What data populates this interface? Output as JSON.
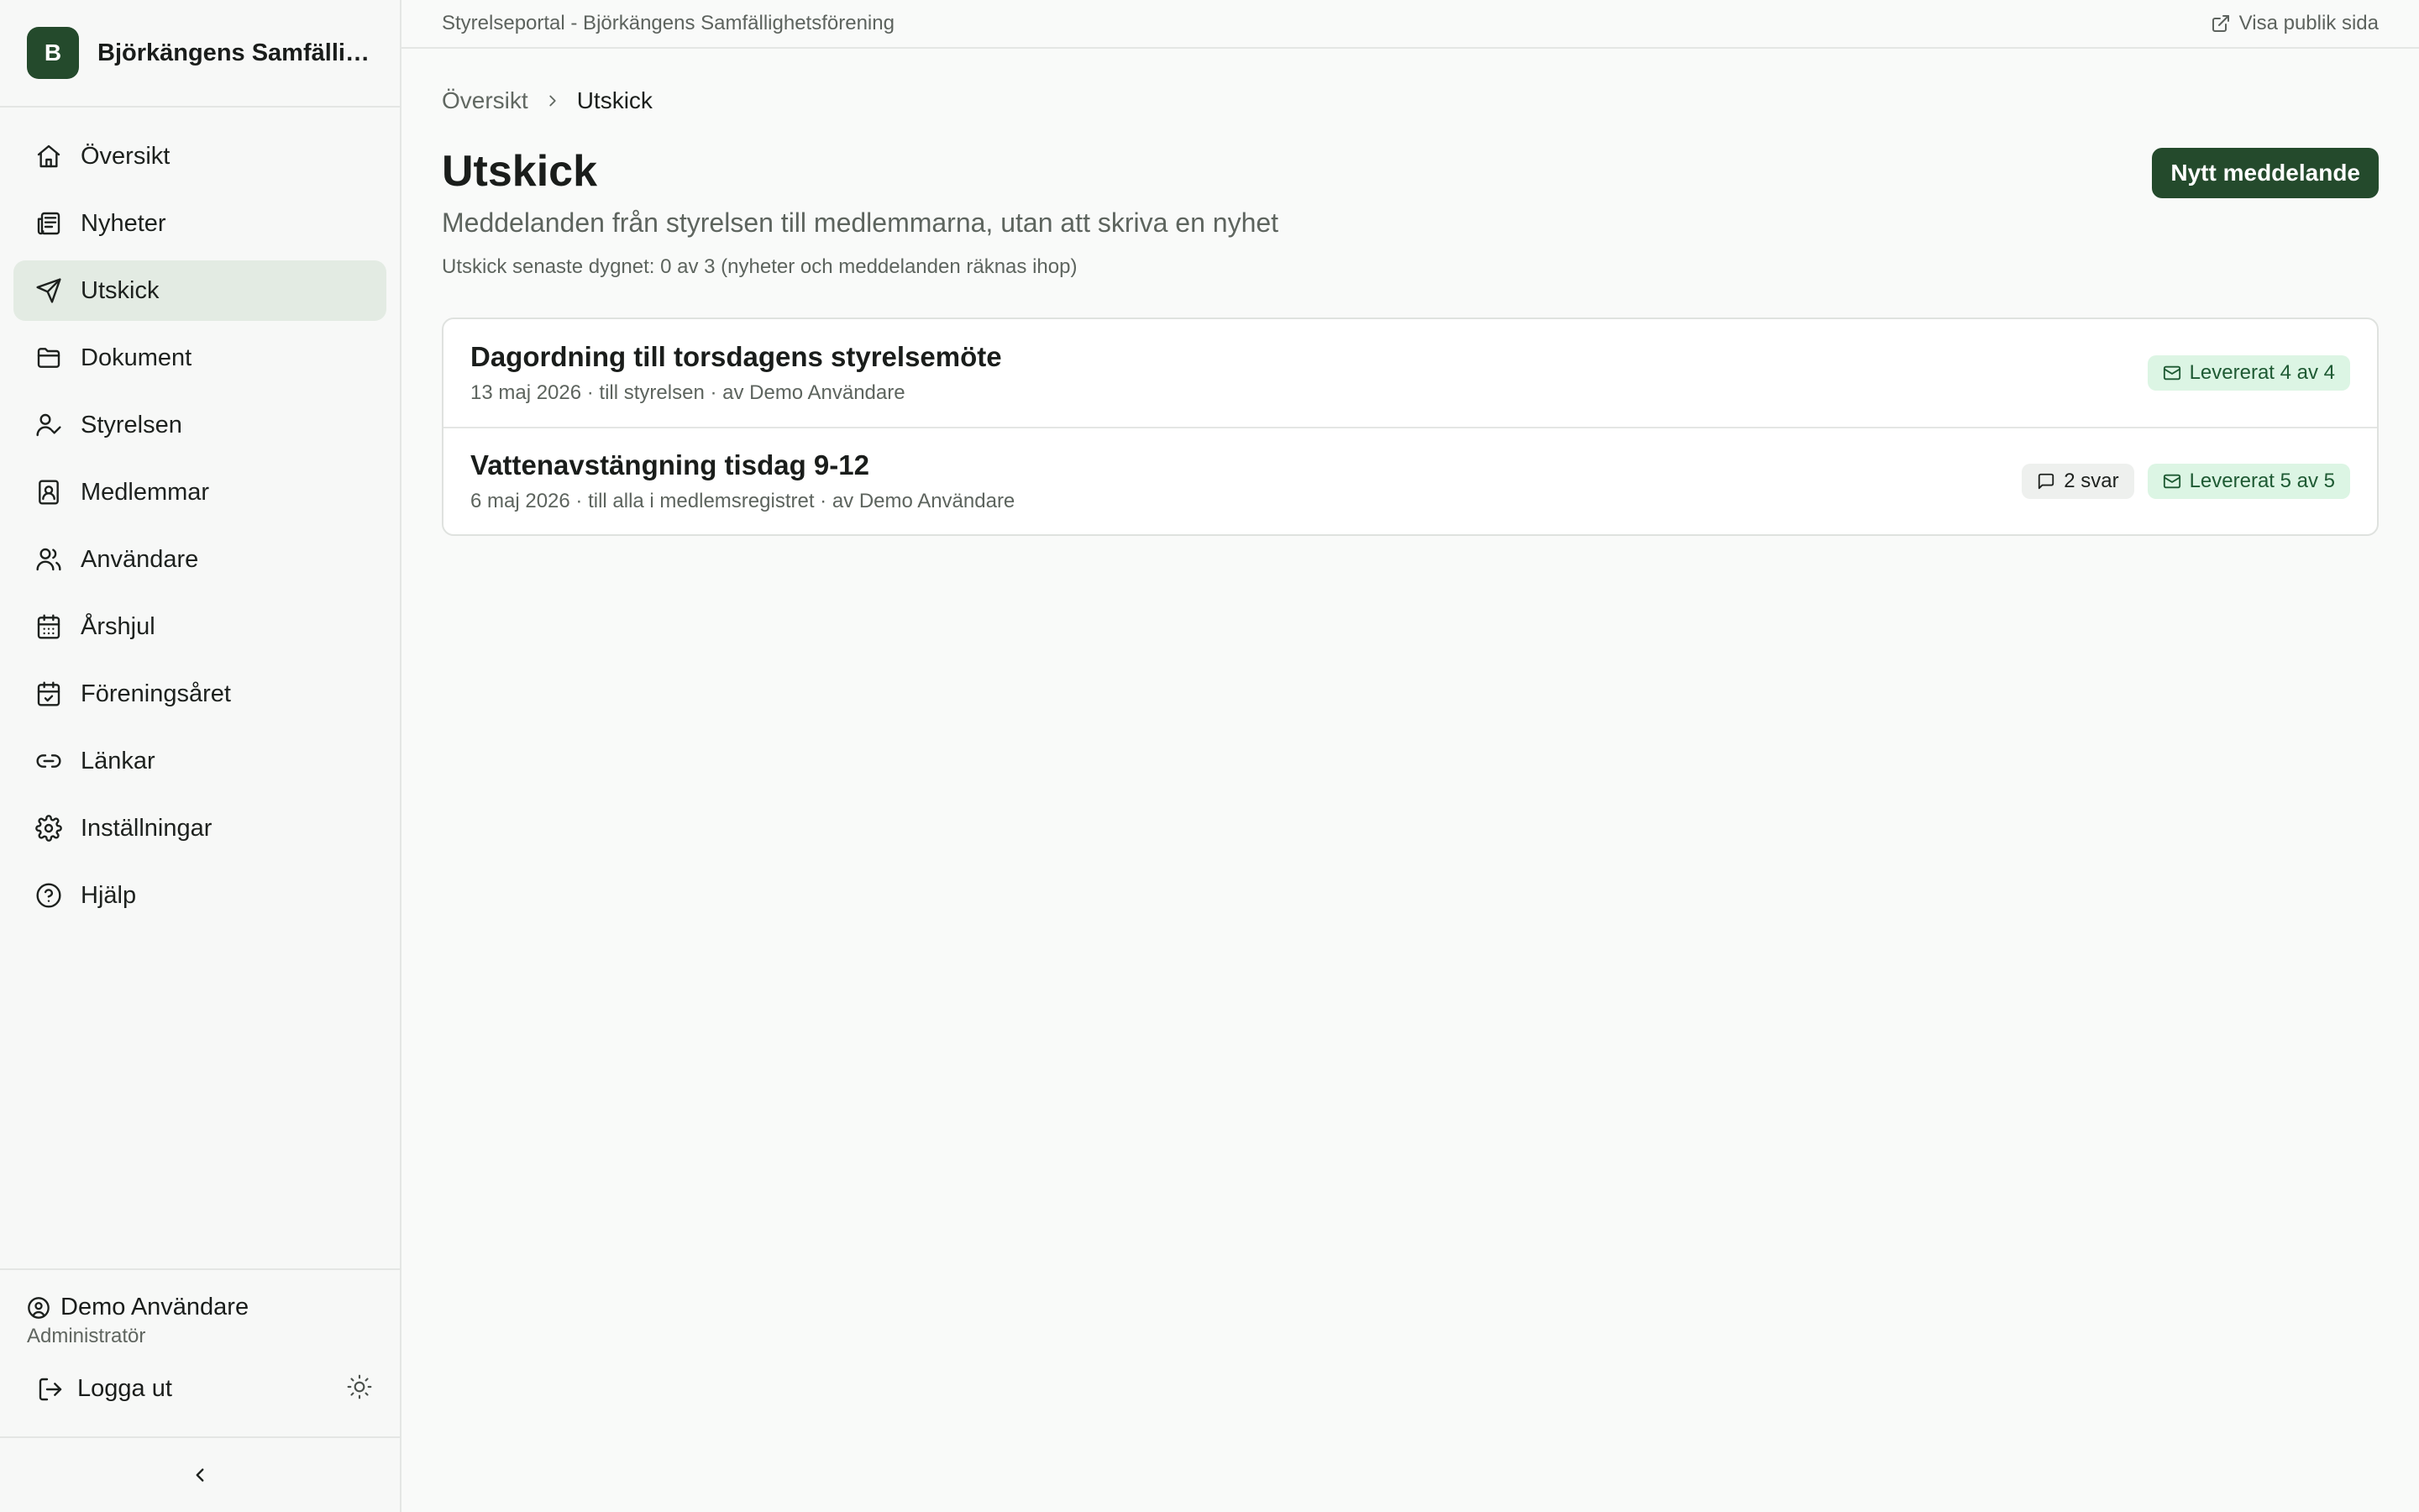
{
  "brand": {
    "initial": "B",
    "name": "Björkängens Samfällig..."
  },
  "nav": [
    {
      "label": "Översikt",
      "icon": "home-icon"
    },
    {
      "label": "Nyheter",
      "icon": "newspaper-icon"
    },
    {
      "label": "Utskick",
      "icon": "send-icon",
      "active": true
    },
    {
      "label": "Dokument",
      "icon": "folder-icon"
    },
    {
      "label": "Styrelsen",
      "icon": "user-check-icon"
    },
    {
      "label": "Medlemmar",
      "icon": "contact-book-icon"
    },
    {
      "label": "Användare",
      "icon": "users-icon"
    },
    {
      "label": "Årshjul",
      "icon": "calendar-icon"
    },
    {
      "label": "Föreningsåret",
      "icon": "calendar-check-icon"
    },
    {
      "label": "Länkar",
      "icon": "link-icon"
    },
    {
      "label": "Inställningar",
      "icon": "gear-icon"
    },
    {
      "label": "Hjälp",
      "icon": "help-icon"
    }
  ],
  "user": {
    "name": "Demo Användare",
    "role": "Administratör",
    "logout": "Logga ut"
  },
  "topbar": {
    "title": "Styrelseportal - Björkängens Samfällighetsförening",
    "public_link": "Visa publik sida"
  },
  "breadcrumb": {
    "root": "Översikt",
    "current": "Utskick"
  },
  "page": {
    "title": "Utskick",
    "subtitle": "Meddelanden från styrelsen till medlemmarna, utan att skriva en nyhet",
    "quota": "Utskick senaste dygnet: 0 av 3 (nyheter och meddelanden räknas ihop)",
    "new_button": "Nytt meddelande"
  },
  "messages": [
    {
      "title": "Dagordning till torsdagens styrelsemöte",
      "meta": "13 maj 2026 · till styrelsen · av Demo Användare",
      "replies": "",
      "delivered": "Levererat 4 av 4"
    },
    {
      "title": "Vattenavstängning tisdag 9-12",
      "meta": "6 maj 2026 · till alla i medlemsregistret · av Demo Användare",
      "replies": "2 svar",
      "delivered": "Levererat 5 av 5"
    }
  ]
}
